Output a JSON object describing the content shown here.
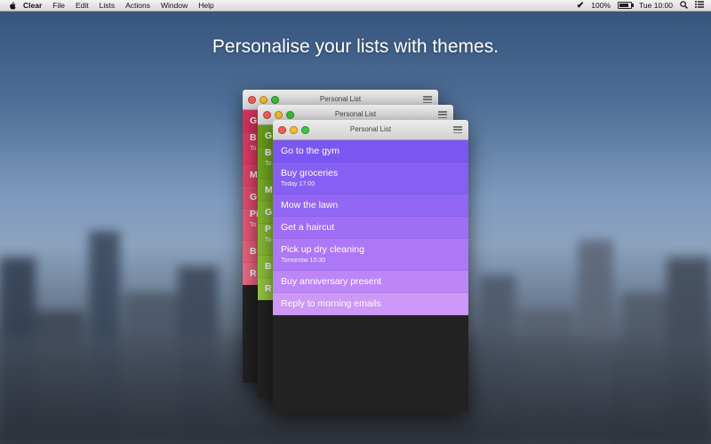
{
  "menubar": {
    "app": "Clear",
    "items": [
      "File",
      "Edit",
      "Lists",
      "Actions",
      "Window",
      "Help"
    ],
    "battery": "100%",
    "clock": "Tue 10:00"
  },
  "headline": "Personalise your lists with themes.",
  "back_windows": [
    {
      "title": "Personal List",
      "rows": [
        {
          "t": "G",
          "color": "#d6335d"
        },
        {
          "t": "B",
          "s": "To",
          "color": "#dd3c63"
        },
        {
          "t": "M",
          "color": "#e14568"
        },
        {
          "t": "G",
          "color": "#e44e6f"
        },
        {
          "t": "Pi",
          "s": "To",
          "color": "#e85876"
        },
        {
          "t": "B",
          "color": "#ea627d"
        },
        {
          "t": "R",
          "color": "#ec6b85"
        }
      ]
    },
    {
      "title": "Personal List",
      "rows": [
        {
          "t": "G",
          "color": "#6a9e1f"
        },
        {
          "t": "B",
          "s": "To",
          "color": "#72a824"
        },
        {
          "t": "M",
          "color": "#79b02a"
        },
        {
          "t": "G",
          "color": "#80b630"
        },
        {
          "t": "P",
          "s": "To",
          "color": "#87bc36"
        },
        {
          "t": "B",
          "color": "#8ec23c"
        },
        {
          "t": "R",
          "color": "#95c642"
        }
      ]
    }
  ],
  "front_window": {
    "title": "Personal List",
    "rows": [
      {
        "t": "Go to the gym",
        "color": "#7b57f2"
      },
      {
        "t": "Buy groceries",
        "s": "Today 17:00",
        "color": "#8660f3"
      },
      {
        "t": "Mow the lawn",
        "color": "#9366f4"
      },
      {
        "t": "Get a haircut",
        "color": "#a06ef5"
      },
      {
        "t": "Pick up dry cleaning",
        "s": "Tomorrow 15:30",
        "color": "#ad78f6"
      },
      {
        "t": "Buy anniversary present",
        "color": "#bd86f7"
      },
      {
        "t": "Reply to morning emails",
        "color": "#cd98f8"
      }
    ]
  }
}
